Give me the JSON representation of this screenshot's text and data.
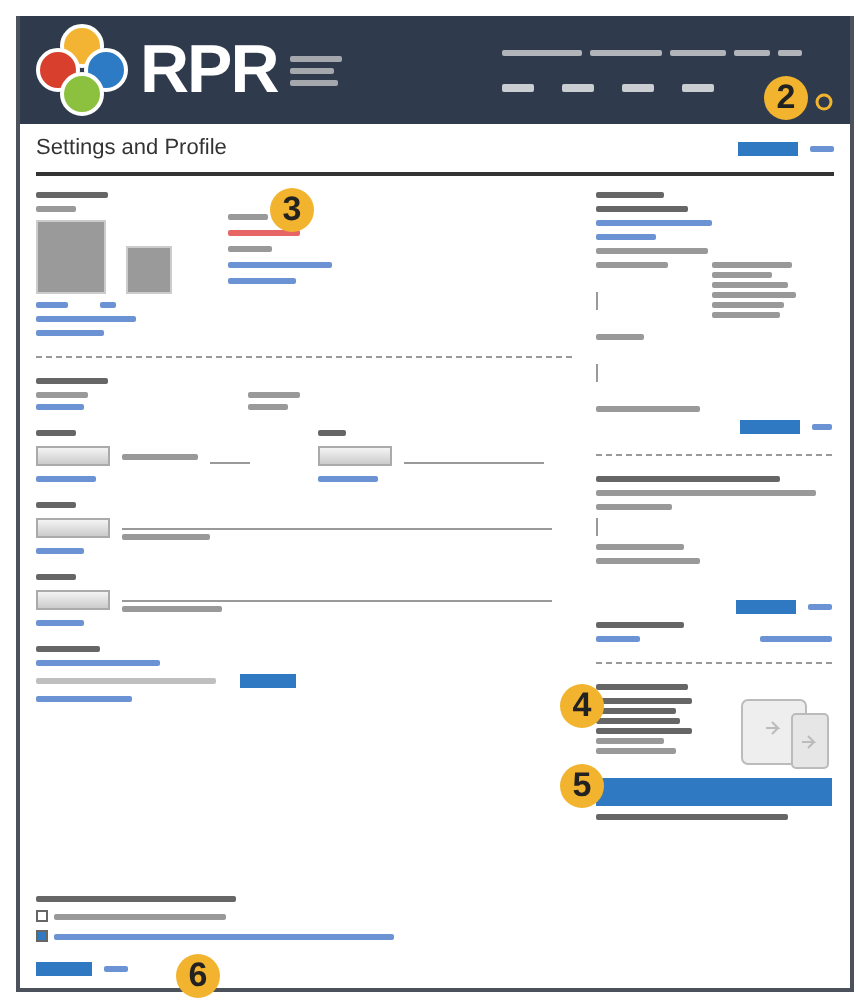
{
  "logo": {
    "text": "RPR"
  },
  "page": {
    "title": "Settings and Profile"
  },
  "checkboxes": [
    {
      "checked": false
    },
    {
      "checked": true
    }
  ],
  "callouts": [
    {
      "label": "2"
    },
    {
      "label": "3"
    },
    {
      "label": "4"
    },
    {
      "label": "5"
    },
    {
      "label": "6"
    }
  ]
}
